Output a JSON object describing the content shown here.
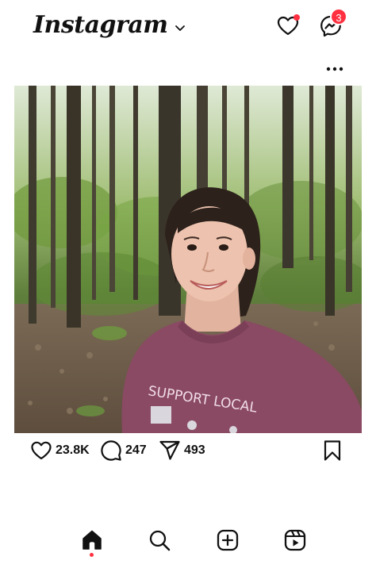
{
  "app": {
    "name": "Instagram"
  },
  "header": {
    "logo_text": "Instagram",
    "dropdown_icon": "chevron-down-icon",
    "notifications_icon": "heart-icon",
    "notifications_dot_color": "#ff3040",
    "messages_icon": "messenger-icon",
    "messages_badge": "3"
  },
  "post": {
    "more_icon": "more-horizontal-icon",
    "image": {
      "description_icon": "photo",
      "shirt_text": "SUPPORT LOCAL"
    },
    "actions": {
      "likes": "23.8K",
      "comments": "247",
      "shares": "493"
    }
  },
  "tabbar": {
    "items": [
      {
        "name": "home",
        "icon": "home-icon",
        "active": true
      },
      {
        "name": "search",
        "icon": "search-icon",
        "active": false
      },
      {
        "name": "create",
        "icon": "plus-square-icon",
        "active": false
      },
      {
        "name": "reels",
        "icon": "reels-icon",
        "active": false
      }
    ],
    "active_dot_color": "#ff3040"
  },
  "colors": {
    "accent": "#ff3040",
    "text": "#111111",
    "background": "#ffffff"
  }
}
